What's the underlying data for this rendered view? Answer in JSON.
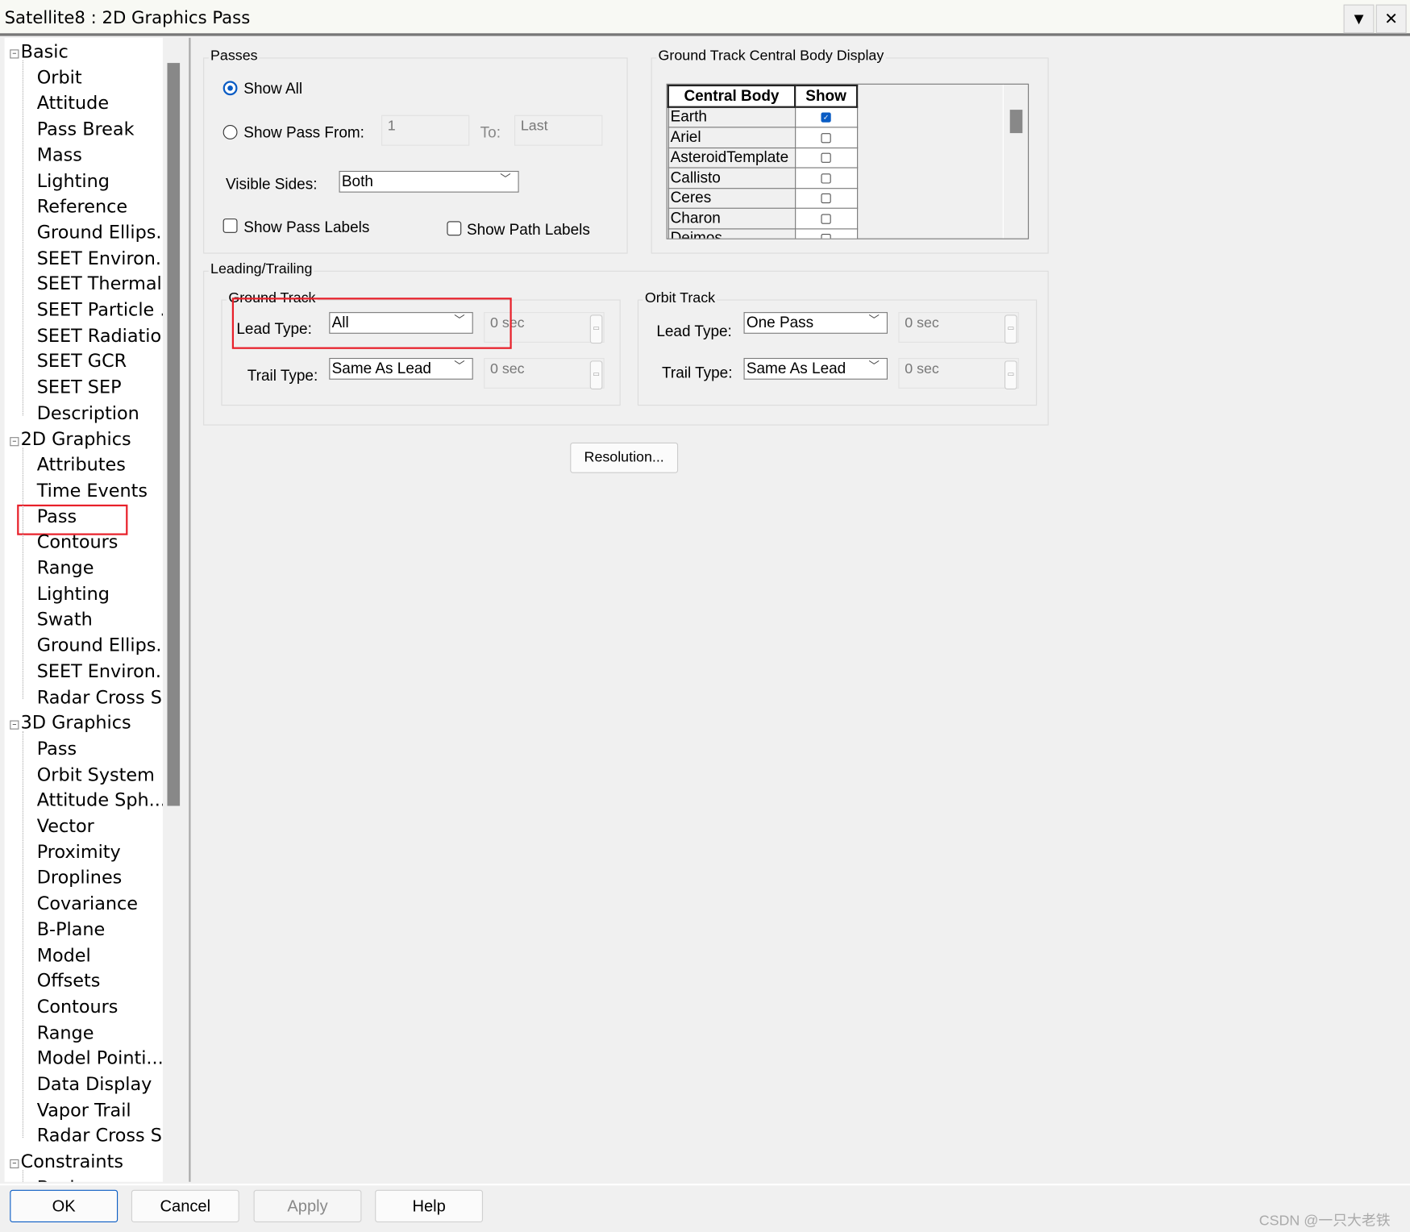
{
  "window": {
    "title": "Satellite8 : 2D Graphics Pass"
  },
  "tree": {
    "groups": [
      {
        "label": "Basic",
        "children": [
          "Orbit",
          "Attitude",
          "Pass Break",
          "Mass",
          "Lighting",
          "Reference",
          "Ground Ellips...",
          "SEET Environ...",
          "SEET Thermal",
          "SEET Particle ...",
          "SEET Radiation",
          "SEET GCR",
          "SEET SEP",
          "Description"
        ]
      },
      {
        "label": "2D Graphics",
        "children": [
          "Attributes",
          "Time Events",
          "Pass",
          "Contours",
          "Range",
          "Lighting",
          "Swath",
          "Ground Ellips...",
          "SEET Environ...",
          "Radar Cross S..."
        ]
      },
      {
        "label": "3D Graphics",
        "children": [
          "Pass",
          "Orbit System",
          "Attitude Sph...",
          "Vector",
          "Proximity",
          "Droplines",
          "Covariance",
          "B-Plane",
          "Model",
          "Offsets",
          "Contours",
          "Range",
          "Model Pointi...",
          "Data Display",
          "Vapor Trail",
          "Radar Cross S..."
        ]
      },
      {
        "label": "Constraints",
        "children": [
          "Basic"
        ]
      }
    ],
    "selected": "2D Graphics/Pass"
  },
  "passes": {
    "title": "Passes",
    "show_all": "Show All",
    "show_pass_from": "Show Pass From:",
    "from_value": "1",
    "to_label": "To:",
    "to_value": "Last",
    "selected_option": "Show All",
    "visible_sides_label": "Visible Sides:",
    "visible_sides": "Both",
    "show_pass_labels": "Show Pass Labels",
    "show_path_labels": "Show Path Labels",
    "show_pass_labels_checked": false,
    "show_path_labels_checked": false
  },
  "central_body": {
    "title": "Ground Track Central Body Display",
    "headers": [
      "Central Body",
      "Show"
    ],
    "rows": [
      {
        "name": "Earth",
        "show": true
      },
      {
        "name": "Ariel",
        "show": false
      },
      {
        "name": "AsteroidTemplate",
        "show": false
      },
      {
        "name": "Callisto",
        "show": false
      },
      {
        "name": "Ceres",
        "show": false
      },
      {
        "name": "Charon",
        "show": false
      },
      {
        "name": "Deimos",
        "show": false
      }
    ]
  },
  "leading_trailing": {
    "title": "Leading/Trailing",
    "ground_track": {
      "title": "Ground Track",
      "lead_label": "Lead Type:",
      "lead_value": "All",
      "lead_time": "0 sec",
      "trail_label": "Trail Type:",
      "trail_value": "Same As Lead",
      "trail_time": "0 sec"
    },
    "orbit_track": {
      "title": "Orbit Track",
      "lead_label": "Lead Type:",
      "lead_value": "One Pass",
      "lead_time": "0 sec",
      "trail_label": "Trail Type:",
      "trail_value": "Same As Lead",
      "trail_time": "0 sec"
    }
  },
  "resolution_button": "Resolution...",
  "footer": {
    "ok": "OK",
    "cancel": "Cancel",
    "apply": "Apply",
    "help": "Help"
  },
  "watermark": "CSDN @一只大老铁",
  "colors": {
    "accent": "#0a5cc4",
    "highlight": "#e8202a"
  }
}
